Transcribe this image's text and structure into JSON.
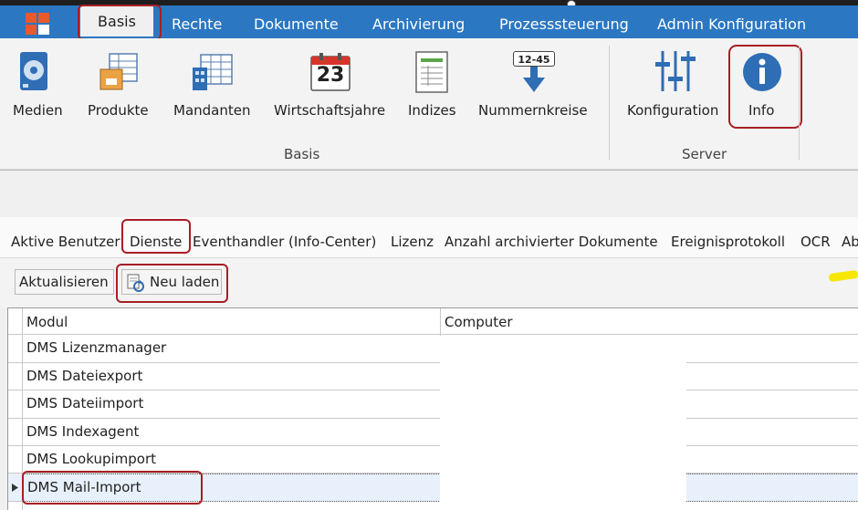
{
  "menu": {
    "tabs": [
      {
        "label": "Basis"
      },
      {
        "label": "Rechte"
      },
      {
        "label": "Dokumente"
      },
      {
        "label": "Archivierung"
      },
      {
        "label": "Prozesssteuerung"
      },
      {
        "label": "Admin Konfiguration"
      }
    ]
  },
  "ribbon": {
    "basis_items": [
      {
        "label": "Medien",
        "icon": "disk-icon"
      },
      {
        "label": "Produkte",
        "icon": "product-box-icon"
      },
      {
        "label": "Mandanten",
        "icon": "building-icon"
      },
      {
        "label": "Wirtschaftsjahre",
        "icon": "calendar-icon"
      },
      {
        "label": "Indizes",
        "icon": "index-sheet-icon"
      },
      {
        "label": "Nummernkreise",
        "icon": "number-range-icon"
      }
    ],
    "calendar_day": "23",
    "number_range_text": "12-45",
    "basis_group_label": "Basis",
    "server_items": [
      {
        "label": "Konfiguration",
        "icon": "sliders-icon"
      },
      {
        "label": "Info",
        "icon": "info-icon"
      }
    ],
    "server_group_label": "Server"
  },
  "subtabs": [
    {
      "label": "Aktive Benutzer"
    },
    {
      "label": "Dienste"
    },
    {
      "label": "Eventhandler (Info-Center)"
    },
    {
      "label": "Lizenz"
    },
    {
      "label": "Anzahl archivierter Dokumente"
    },
    {
      "label": "Ereignisprotokoll"
    },
    {
      "label": "OCR"
    },
    {
      "label": "Ab"
    }
  ],
  "toolbar": {
    "refresh_label": "Aktualisieren",
    "reload_label": "Neu laden"
  },
  "grid": {
    "columns": [
      "Modul",
      "Computer"
    ],
    "rows": [
      {
        "modul": "DMS Lizenzmanager",
        "computer": ""
      },
      {
        "modul": "DMS Dateiexport",
        "computer": ""
      },
      {
        "modul": "DMS Dateiimport",
        "computer": ""
      },
      {
        "modul": "DMS Indexagent",
        "computer": ""
      },
      {
        "modul": "DMS Lookupimport",
        "computer": ""
      },
      {
        "modul": "DMS Mail-Import",
        "computer": ""
      }
    ],
    "selected_index": 5
  },
  "colors": {
    "menubar": "#2b77c2",
    "highlight": "#a81e25",
    "info_blue": "#2f6db4"
  }
}
